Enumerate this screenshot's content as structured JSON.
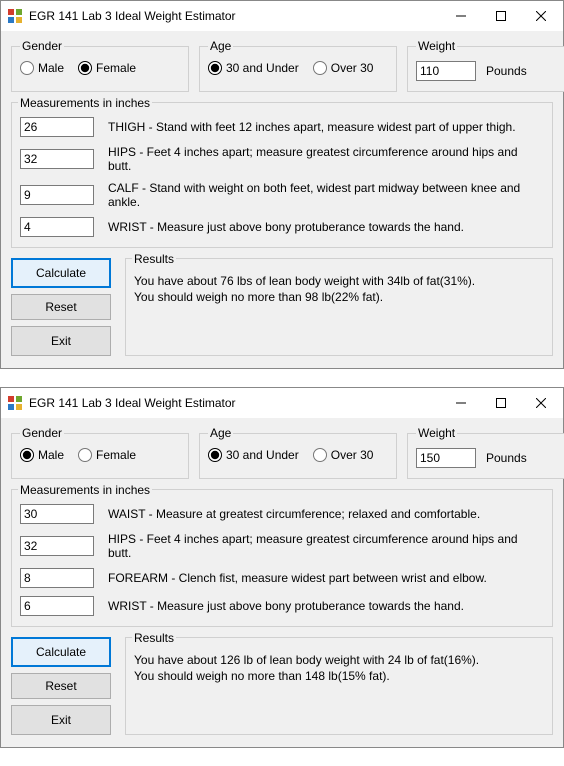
{
  "windows": [
    {
      "title": "EGR 141 Lab 3 Ideal Weight Estimator",
      "gender": {
        "legend": "Gender",
        "male_label": "Male",
        "female_label": "Female",
        "selected": "Female"
      },
      "age": {
        "legend": "Age",
        "under_label": "30 and Under",
        "over_label": "Over 30",
        "selected": "30 and Under"
      },
      "weight": {
        "legend": "Weight",
        "value": "110",
        "units": "Pounds"
      },
      "measurements": {
        "legend": "Measurements in inches",
        "rows": [
          {
            "value": "26",
            "desc": "THIGH - Stand with feet 12 inches apart, measure widest part of upper thigh."
          },
          {
            "value": "32",
            "desc": "HIPS - Feet 4 inches apart; measure greatest circumference around hips and butt."
          },
          {
            "value": "9",
            "desc": "CALF - Stand with weight on both feet, widest part midway between knee and ankle."
          },
          {
            "value": "4",
            "desc": "WRIST - Measure just above bony protuberance towards the hand."
          }
        ]
      },
      "buttons": {
        "calculate": "Calculate",
        "reset": "Reset",
        "exit": "Exit"
      },
      "results": {
        "legend": "Results",
        "line1": "You have about 76 lbs of lean body weight with 34lb of fat(31%).",
        "line2": "You should weigh no more than 98 lb(22% fat)."
      }
    },
    {
      "title": "EGR 141 Lab 3 Ideal Weight Estimator",
      "gender": {
        "legend": "Gender",
        "male_label": "Male",
        "female_label": "Female",
        "selected": "Male"
      },
      "age": {
        "legend": "Age",
        "under_label": "30 and Under",
        "over_label": "Over 30",
        "selected": "30 and Under"
      },
      "weight": {
        "legend": "Weight",
        "value": "150",
        "units": "Pounds"
      },
      "measurements": {
        "legend": "Measurements in inches",
        "rows": [
          {
            "value": "30",
            "desc": "WAIST - Measure at greatest circumference; relaxed and comfortable."
          },
          {
            "value": "32",
            "desc": "HIPS - Feet 4 inches apart; measure greatest circumference around hips and butt."
          },
          {
            "value": "8",
            "desc": "FOREARM - Clench fist, measure widest part between wrist and elbow."
          },
          {
            "value": "6",
            "desc": "WRIST - Measure just above bony protuberance towards the hand."
          }
        ]
      },
      "buttons": {
        "calculate": "Calculate",
        "reset": "Reset",
        "exit": "Exit"
      },
      "results": {
        "legend": "Results",
        "line1": "You have about 126 lb of lean body weight with 24 lb of fat(16%).",
        "line2": "You should weigh no more than 148 lb(15% fat)."
      }
    }
  ]
}
